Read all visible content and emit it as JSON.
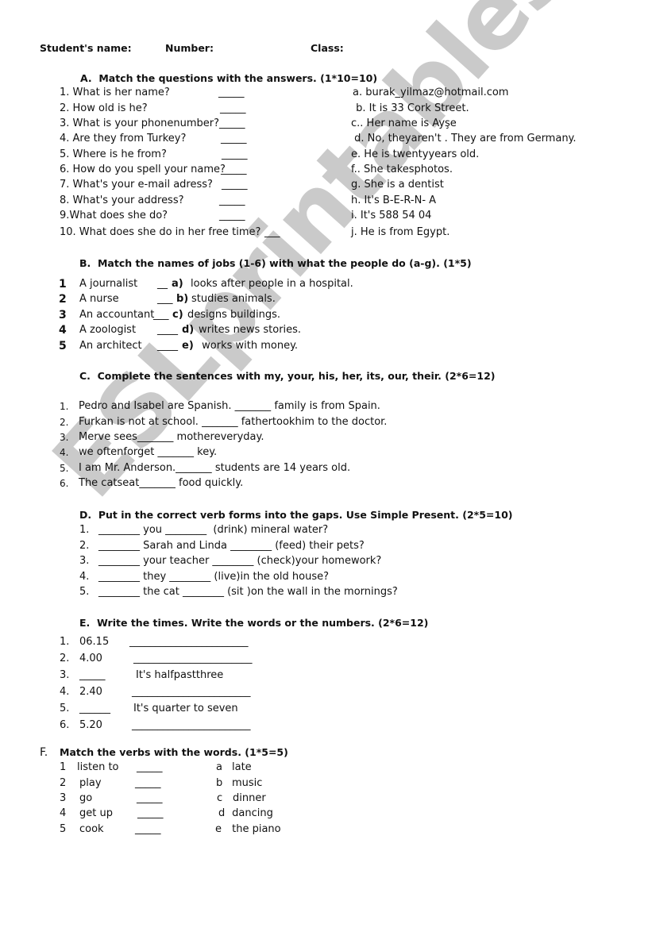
{
  "header": {
    "student_name_label": "Student's name:",
    "number_label": "Number:",
    "class_label": "Class:"
  },
  "watermark": "ESLprintables.com",
  "section_a": {
    "title": "A.  Match the questions with the answers. (1*10=10)",
    "questions": [
      {
        "text": "1. What is her name?",
        "blank": "_____"
      },
      {
        "text": "2. How old is he?",
        "blank": "_____"
      },
      {
        "text": "3. What is your phonenumber?",
        "blank": "_____"
      },
      {
        "text": "4. Are they from Turkey?",
        "blank": "_____"
      },
      {
        "text": "5. Where is he from?",
        "blank": "_____"
      },
      {
        "text": "6. How do you spell your name?",
        "blank": "_____"
      },
      {
        "text": "7. What's your e-mail adress?",
        "blank": "_____"
      },
      {
        "text": "8. What's your address?",
        "blank": "_____"
      },
      {
        "text": "9.What does she do?",
        "blank": "_____"
      },
      {
        "text": "10. What does she do in her free time?",
        "blank": "___"
      }
    ],
    "answers": [
      "a. burak_yilmaz@hotmail.com",
      " b. It is 33 Cork Street.",
      "c.. Her name is Ayşe",
      " d. No, theyaren't . They are from Germany.",
      "e. He is twentyyears old.",
      "f.. She takesphotos.",
      "g. She is a dentist",
      "h. It's B-E-R-N- A",
      "i. It's 588 54 04",
      "j. He is from Egypt."
    ]
  },
  "section_b": {
    "title": "B.  Match the names of jobs (1-6) with what the people do (a-g). (1*5)",
    "rows": [
      {
        "num": "1",
        "job": "A journalist",
        "blank": "__",
        "letter": "a)",
        "desc": "looks after people in a hospital."
      },
      {
        "num": "2",
        "job": "A nurse",
        "blank": "___",
        "letter": "b)",
        "desc": "studies animals."
      },
      {
        "num": "3",
        "job": "An accountant",
        "blank": "___",
        "letter": "c)",
        "desc": "designs buildings."
      },
      {
        "num": "4",
        "job": "A zoologist",
        "blank": "____",
        "letter": "d)",
        "desc": "writes news stories."
      },
      {
        "num": "5",
        "job": "An architect",
        "blank": "____",
        "letter": "e)",
        "desc": " works with money."
      }
    ]
  },
  "section_c": {
    "title": "C.  Complete the sentences with my, your, his, her, its, our, their. (2*6=12)",
    "items": [
      {
        "num": "1.",
        "text": "Pedro and Isabel are Spanish. _______ family is from Spain."
      },
      {
        "num": "2.",
        "text": "Furkan is not at school. _______ fathertookhim to the doctor."
      },
      {
        "num": "3.",
        "text": "Merve sees_______ mothereveryday."
      },
      {
        "num": "4.",
        "text": "we oftenforget _______ key."
      },
      {
        "num": "5.",
        "text": "I am Mr. Anderson._______ students are 14 years old."
      },
      {
        "num": "6.",
        "text": "The catseat_______ food quickly."
      }
    ]
  },
  "section_d": {
    "title": "D.  Put in the correct verb forms into the gaps. Use Simple Present. (2*5=10)",
    "items": [
      {
        "num": "1.",
        "text": "________ you ________  (drink) mineral water?"
      },
      {
        "num": "2.",
        "text": "________ Sarah and Linda ________ (feed) their pets?"
      },
      {
        "num": "3.",
        "text": "________ your teacher ________ (check)your homework?"
      },
      {
        "num": "4.",
        "text": "________ they ________ (live)in the old house?"
      },
      {
        "num": "5.",
        "text": "________ the cat ________ (sit )on the wall in the mornings?"
      }
    ]
  },
  "section_e": {
    "title": "E.  Write the times. Write the words or the numbers. (2*6=12)",
    "items": [
      {
        "num": "1.",
        "left": "06.15",
        "right": "_______________________"
      },
      {
        "num": "2.",
        "left": "4.00",
        "right": "_______________________"
      },
      {
        "num": "3.",
        "left": "_____",
        "right": "It's halfpastthree"
      },
      {
        "num": "4.",
        "left": "2.40",
        "right": "_______________________"
      },
      {
        "num": "5.",
        "left": "______",
        "right": "It's quarter to seven"
      },
      {
        "num": "6.",
        "left": "5.20",
        "right": "_______________________"
      }
    ]
  },
  "section_f": {
    "label": "F.",
    "title": "Match the verbs with the words. (1*5=5)",
    "rows": [
      {
        "num": "1",
        "verb": "listen to",
        "blank": "_____",
        "letter": "a",
        "word": "late"
      },
      {
        "num": "2",
        "verb": "play",
        "blank": "_____",
        "letter": "b",
        "word": "music"
      },
      {
        "num": "3",
        "verb": "go",
        "blank": "_____",
        "letter": "c",
        "word": "dinner"
      },
      {
        "num": "4",
        "verb": "get up",
        "blank": "_____",
        "letter": "d",
        "word": " dancing"
      },
      {
        "num": "5",
        "verb": "cook",
        "blank": "_____",
        "letter": "e",
        "word": " the piano"
      }
    ]
  }
}
